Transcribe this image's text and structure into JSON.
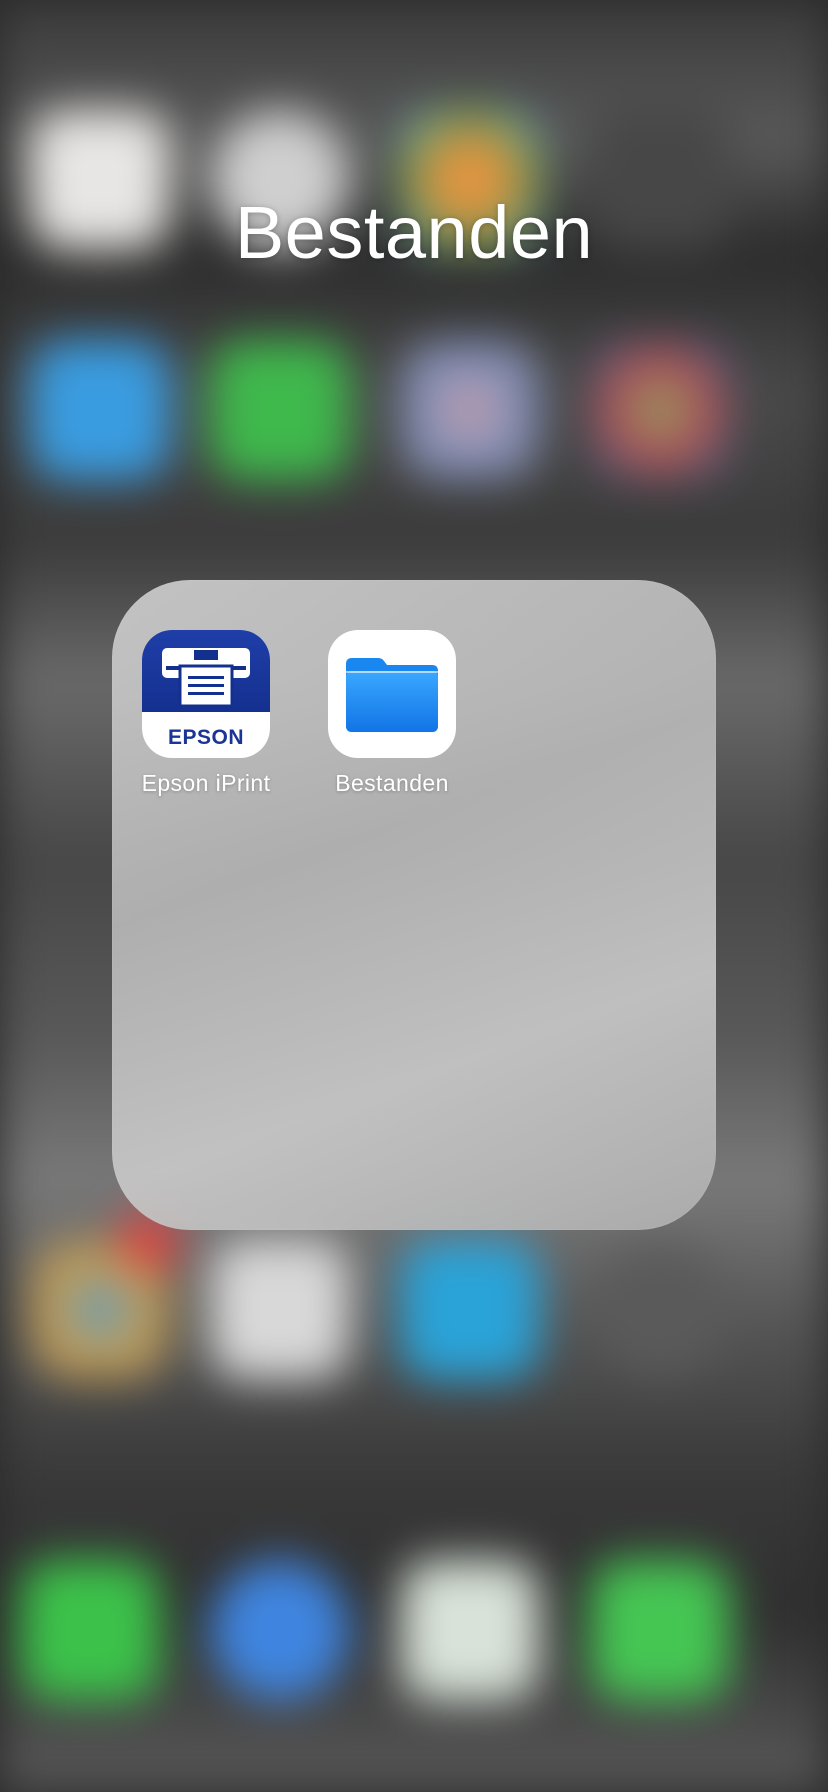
{
  "folder": {
    "title": "Bestanden",
    "apps": [
      {
        "label": "Epson iPrint",
        "icon": "epson-iprint-icon",
        "logo_text": "EPSON"
      },
      {
        "label": "Bestanden",
        "icon": "files-folder-icon"
      }
    ]
  },
  "colors": {
    "epson_blue": "#1a3596",
    "files_blue": "#1e8cf5",
    "label": "#ffffff"
  }
}
